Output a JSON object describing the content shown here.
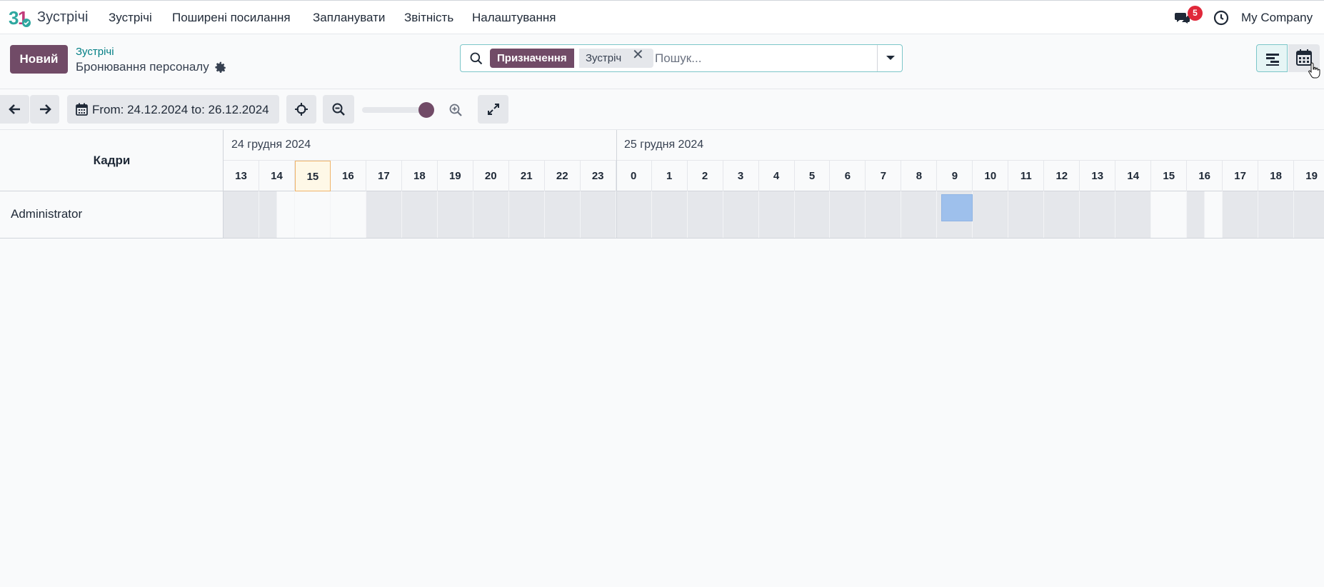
{
  "app": {
    "name": "Зустрічі",
    "logo_icon": "odoo-calendar-logo"
  },
  "menu": [
    "Зустрічі",
    "Поширені посилання",
    "Запланувати",
    "Звітність",
    "Налаштування"
  ],
  "systray": {
    "messages_count": "5",
    "company": "My Company"
  },
  "control": {
    "new_label": "Новий",
    "breadcrumb_parent": "Зустрічі",
    "breadcrumb_current": "Бронювання персоналу"
  },
  "search": {
    "facet_label": "Призначення",
    "facet_value": "Зустріч",
    "placeholder": "Пошук..."
  },
  "gantt": {
    "range_label": "From: 24.12.2024 to: 26.12.2024",
    "zoom_level": 1.0,
    "group_header": "Кадри",
    "days": [
      "24 грудня 2024",
      "25 грудня 2024"
    ],
    "hours": [
      "13",
      "14",
      "15",
      "16",
      "17",
      "18",
      "19",
      "20",
      "21",
      "22",
      "23",
      "0",
      "1",
      "2",
      "3",
      "4",
      "5",
      "6",
      "7",
      "8",
      "9",
      "10",
      "11",
      "12",
      "13",
      "14",
      "15",
      "16",
      "17",
      "18",
      "19"
    ],
    "today_hour_index": 2,
    "rows": [
      {
        "name": "Administrator"
      }
    ],
    "accent": "#714b67",
    "slot_color": "#9ec0ec"
  }
}
